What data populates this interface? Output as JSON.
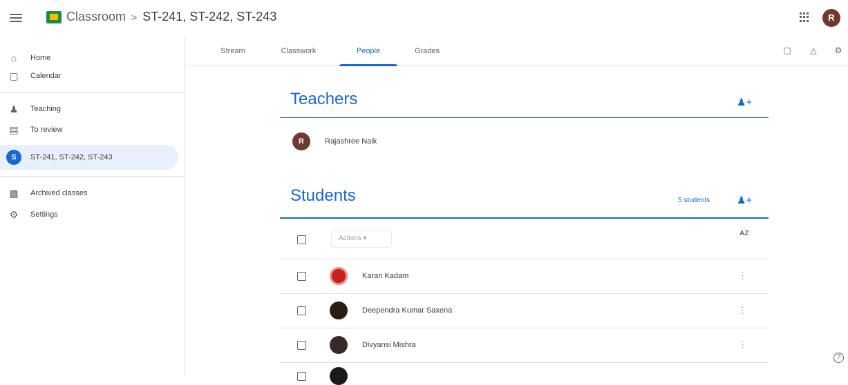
{
  "header": {
    "app_name": "Classroom",
    "separator": ">",
    "class_name": "ST-241, ST-242, ST-243",
    "avatar_letter": "R",
    "menu_icon": "hamburger-menu-icon",
    "apps_icon": "google-apps-grid-icon"
  },
  "sidebar": {
    "items": [
      {
        "label": "Home",
        "icon": "home-icon"
      },
      {
        "label": "Calendar",
        "icon": "calendar-icon"
      },
      {
        "label": "Teaching",
        "icon": "people-icon"
      },
      {
        "label": "To review",
        "icon": "folder-icon"
      },
      {
        "label": "ST-241, ST-242, ST-243",
        "icon": "class-avatar",
        "letter": "S",
        "active": true
      },
      {
        "label": "Archived classes",
        "icon": "archive-icon"
      },
      {
        "label": "Settings",
        "icon": "settings-icon"
      }
    ]
  },
  "tabs": [
    {
      "label": "Stream"
    },
    {
      "label": "Classwork"
    },
    {
      "label": "People",
      "active": true
    },
    {
      "label": "Grades"
    }
  ],
  "toolbar_icons": [
    "calendar-icon",
    "drive-icon",
    "settings-icon"
  ],
  "teachers": {
    "title": "Teachers",
    "people": [
      {
        "name": "Rajashree Naik",
        "letter": "R",
        "color": "#6d3b2e"
      }
    ]
  },
  "students": {
    "title": "Students",
    "count_label": "5 students",
    "actions_label": "Actions",
    "sort_label": "AZ",
    "people": [
      {
        "name": "Karan Kadam",
        "color": "#c5221f"
      },
      {
        "name": "Deependra Kumar Saxena",
        "color": "#2b1d16"
      },
      {
        "name": "Divyansi Mishra",
        "color": "#3a2a2a"
      }
    ]
  },
  "accent_color": "#1967d2"
}
